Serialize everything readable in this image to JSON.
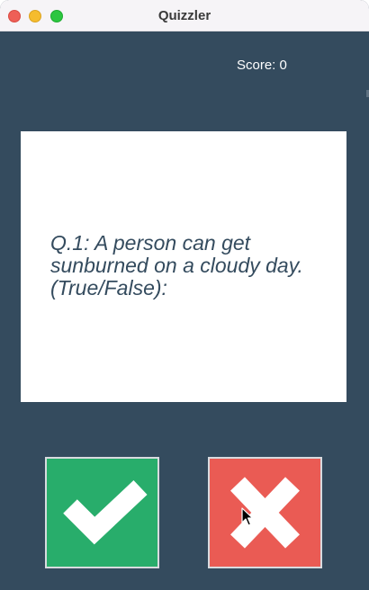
{
  "window": {
    "title": "Quizzler"
  },
  "score": {
    "text": "Score: 0"
  },
  "question": {
    "text": "Q.1: A person can get sunburned on a cloudy day. (True/False):"
  },
  "buttons": {
    "true_icon": "checkmark-icon",
    "false_icon": "cross-icon"
  },
  "colors": {
    "background": "#344b5e",
    "true_button": "#28ad6b",
    "false_button": "#ea5b54",
    "card": "#ffffff"
  }
}
